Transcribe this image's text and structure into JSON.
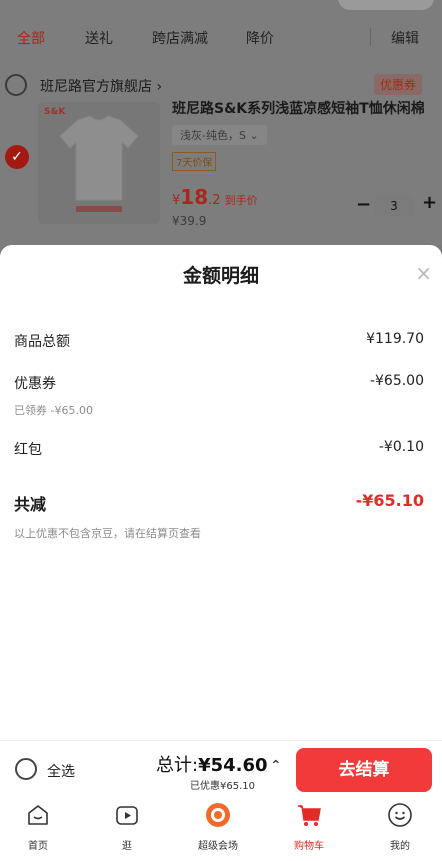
{
  "background": {
    "tabs": [
      {
        "label": "全部"
      },
      {
        "label": "送礼"
      },
      {
        "label": "跨店满减"
      },
      {
        "label": "降价"
      },
      {
        "label": "编辑"
      }
    ],
    "store": {
      "name": "班尼路官方旗舰店 ›",
      "coupon_label": "优惠券"
    },
    "product": {
      "image_brand": "S&K",
      "name": "班尼路S&K系列浅蓝凉感短袖T恤休闲棉",
      "sku": "浅灰-纯色，S ⌄",
      "guarantee": "7天价保",
      "price_symbol": "¥",
      "price_int": "18",
      "price_dec": ".2",
      "price_suffix": "到手价",
      "original_price": "¥39.9",
      "quantity": "3",
      "minus": "−",
      "plus": "+"
    }
  },
  "sheet": {
    "title": "金额明细",
    "close": "×",
    "rows": [
      {
        "label": "商品总额",
        "value": "¥119.70"
      },
      {
        "label": "优惠券",
        "value": "-¥65.00",
        "note": "已领券 -¥65.00"
      },
      {
        "label": "红包",
        "value": "-¥0.10"
      }
    ],
    "total_label": "共减",
    "total_value": "-¥65.10",
    "footnote": "以上优惠不包含京豆，请在结算页查看"
  },
  "bottom_bar": {
    "select_all": "全选",
    "total_prefix": "总计:",
    "total_amount": "¥54.60",
    "discount_note": "已优惠¥65.10",
    "caret": "⌃",
    "checkout": "去结算"
  },
  "nav": [
    {
      "label": "首页",
      "icon": "home-icon"
    },
    {
      "label": "逛",
      "icon": "video-icon"
    },
    {
      "label": "超级会场",
      "icon": "super-venue-icon"
    },
    {
      "label": "购物车",
      "icon": "cart-icon",
      "active": true
    },
    {
      "label": "我的",
      "icon": "profile-icon"
    }
  ],
  "colors": {
    "accent": "#e22c28",
    "checkout": "#f23a3a"
  }
}
